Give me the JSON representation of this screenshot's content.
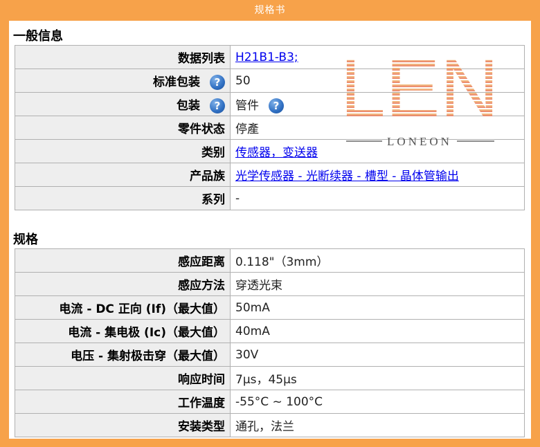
{
  "banner": {
    "title": "规格书"
  },
  "general": {
    "title": "一般信息",
    "rows": [
      {
        "label": "数据列表",
        "value": "H21B1-B3;",
        "link": true
      },
      {
        "label": "标准包装",
        "value": "50",
        "help_label": true
      },
      {
        "label": "包装",
        "value": "管件",
        "help_label": true,
        "help_value": true
      },
      {
        "label": "零件状态",
        "value": "停產"
      },
      {
        "label": "类别",
        "value": "传感器，变送器",
        "link": true
      },
      {
        "label": "产品族",
        "value": "光学传感器 - 光断续器 - 槽型 - 晶体管输出",
        "link": true
      },
      {
        "label": "系列",
        "value": "-"
      }
    ]
  },
  "specs": {
    "title": "规格",
    "rows": [
      {
        "label": "感应距离",
        "value": "0.118\"（3mm）"
      },
      {
        "label": "感应方法",
        "value": "穿透光束"
      },
      {
        "label": "电流 - DC 正向 (If)（最大值）",
        "value": "50mA"
      },
      {
        "label": "电流 - 集电极 (Ic)（最大值）",
        "value": "40mA"
      },
      {
        "label": "电压 - 集射极击穿（最大值）",
        "value": "30V"
      },
      {
        "label": "响应时间",
        "value": "7μs，45μs"
      },
      {
        "label": "工作温度",
        "value": "-55°C ~ 100°C"
      },
      {
        "label": "安装类型",
        "value": "通孔，法兰"
      }
    ]
  },
  "help_icon_glyph": "?",
  "watermark": {
    "letters": "LEN",
    "brand": "LONEON",
    "color_top": "#f3c27a",
    "color_bottom": "#e8705a"
  }
}
